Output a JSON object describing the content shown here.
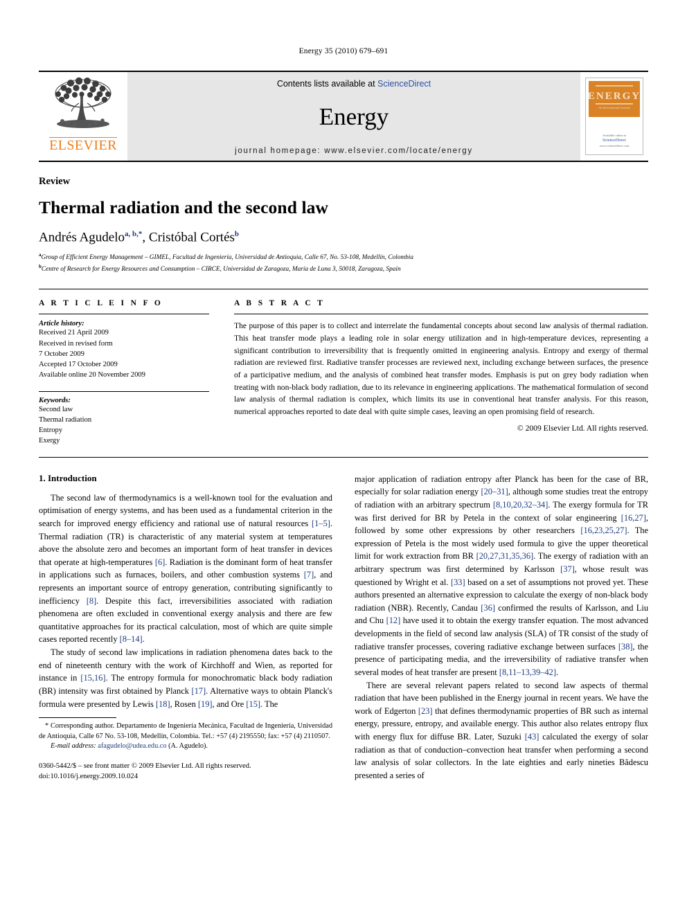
{
  "running_head": "Energy 35 (2010) 679–691",
  "masthead": {
    "publisher_name": "ELSEVIER",
    "contents_prefix": "Contents lists available at ",
    "contents_link": "ScienceDirect",
    "journal_name": "Energy",
    "homepage": "journal homepage: www.elsevier.com/locate/energy",
    "cover": {
      "band_word": "ENERGY",
      "band_sub": "An International Journal",
      "foot_line1": "Available online at",
      "foot_line2": "ScienceDirect",
      "foot_line3": "www.sciencedirect.com"
    },
    "link_color": "#2b50a1",
    "brand_color": "#ef7d1a",
    "band_color": "#d98326"
  },
  "article": {
    "type": "Review",
    "title": "Thermal radiation and the second law",
    "authors_html": "Andrés Agudelo, Cristóbal Cortés",
    "author1": "Andrés Agudelo",
    "author1_sup": "a, b,*",
    "author2": "Cristóbal Cortés",
    "author2_sup": "b",
    "affiliation_a_marker": "a",
    "affiliation_a": "Group of Efficient Energy Management – GIMEL, Facultad de Ingeniería, Universidad de Antioquia, Calle 67, No. 53-108, Medellín, Colombia",
    "affiliation_b_marker": "b",
    "affiliation_b": "Centre of Research for Energy Resources and Consumption – CIRCE, Universidad de Zaragoza, María de Luna 3, 50018, Zaragoza, Spain"
  },
  "info": {
    "heading": "A R T I C L E   I N F O",
    "history_label": "Article history:",
    "history": [
      "Received 21 April 2009",
      "Received in revised form",
      "7 October 2009",
      "Accepted 17 October 2009",
      "Available online 20 November 2009"
    ],
    "keywords_label": "Keywords:",
    "keywords": [
      "Second law",
      "Thermal radiation",
      "Entropy",
      "Exergy"
    ]
  },
  "abstract": {
    "heading": "A B S T R A C T",
    "text": "The purpose of this paper is to collect and interrelate the fundamental concepts about second law analysis of thermal radiation. This heat transfer mode plays a leading role in solar energy utilization and in high-temperature devices, representing a significant contribution to irreversibility that is frequently omitted in engineering analysis. Entropy and exergy of thermal radiation are reviewed first. Radiative transfer processes are reviewed next, including exchange between surfaces, the presence of a participative medium, and the analysis of combined heat transfer modes. Emphasis is put on grey body radiation when treating with non-black body radiation, due to its relevance in engineering applications. The mathematical formulation of second law analysis of thermal radiation is complex, which limits its use in conventional heat transfer analysis. For this reason, numerical approaches reported to date deal with quite simple cases, leaving an open promising field of research.",
    "copyright": "© 2009 Elsevier Ltd. All rights reserved."
  },
  "body": {
    "section_title": "1. Introduction",
    "left_paragraphs": [
      "The second law of thermodynamics is a well-known tool for the evaluation and optimisation of energy systems, and has been used as a fundamental criterion in the search for improved energy efficiency and rational use of natural resources [1–5]. Thermal radiation (TR) is characteristic of any material system at temperatures above the absolute zero and becomes an important form of heat transfer in devices that operate at high-temperatures [6]. Radiation is the dominant form of heat transfer in applications such as furnaces, boilers, and other combustion systems [7], and represents an important source of entropy generation, contributing significantly to inefficiency [8]. Despite this fact, irreversibilities associated with radiation phenomena are often excluded in conventional exergy analysis and there are few quantitative approaches for its practical calculation, most of which are quite simple cases reported recently [8–14].",
      "The study of second law implications in radiation phenomena dates back to the end of nineteenth century with the work of Kirchhoff and Wien, as reported for instance in [15,16]. The entropy formula for monochromatic black body radiation (BR) intensity was first obtained by Planck [17]. Alternative ways to obtain Planck's formula were presented by Lewis [18], Rosen [19], and Ore [15]. The"
    ],
    "right_paragraphs": [
      "major application of radiation entropy after Planck has been for the case of BR, especially for solar radiation energy [20–31], although some studies treat the entropy of radiation with an arbitrary spectrum [8,10,20,32–34]. The exergy formula for TR was first derived for BR by Petela in the context of solar engineering [16,27], followed by some other expressions by other researchers [16,23,25,27]. The expression of Petela is the most widely used formula to give the upper theoretical limit for work extraction from BR [20,27,31,35,36]. The exergy of radiation with an arbitrary spectrum was first determined by Karlsson [37], whose result was questioned by Wright et al. [33] based on a set of assumptions not proved yet. These authors presented an alternative expression to calculate the exergy of non-black body radiation (NBR). Recently, Candau [36] confirmed the results of Karlsson, and Liu and Chu [12] have used it to obtain the exergy transfer equation. The most advanced developments in the field of second law analysis (SLA) of TR consist of the study of radiative transfer processes, covering radiative exchange between surfaces [38], the presence of participating media, and the irreversibility of radiative transfer when several modes of heat transfer are present [8,11–13,39–42].",
      "There are several relevant papers related to second law aspects of thermal radiation that have been published in the Energy journal in recent years. We have the work of Edgerton [23] that defines thermodynamic properties of BR such as internal energy, pressure, entropy, and available energy. This author also relates entropy flux with energy flux for diffuse BR. Later, Suzuki [43] calculated the exergy of solar radiation as that of conduction–convection heat transfer when performing a second law analysis of solar collectors. In the late eighties and early nineties Bădescu presented a series of"
    ]
  },
  "footnote": {
    "corresponding": "* Corresponding author. Departamento de Ingeniería Mecánica, Facultad de Ingeniería, Universidad de Antioquia, Calle 67 No. 53-108, Medellín, Colombia. Tel.: +57 (4) 2195550; fax: +57 (4) 2110507.",
    "email_label": "E-mail address:",
    "email": "afagudelo@udea.edu.co",
    "email_owner": "(A. Agudelo).",
    "frontmatter": "0360-5442/$ – see front matter © 2009 Elsevier Ltd. All rights reserved.",
    "doi": "doi:10.1016/j.energy.2009.10.024"
  }
}
